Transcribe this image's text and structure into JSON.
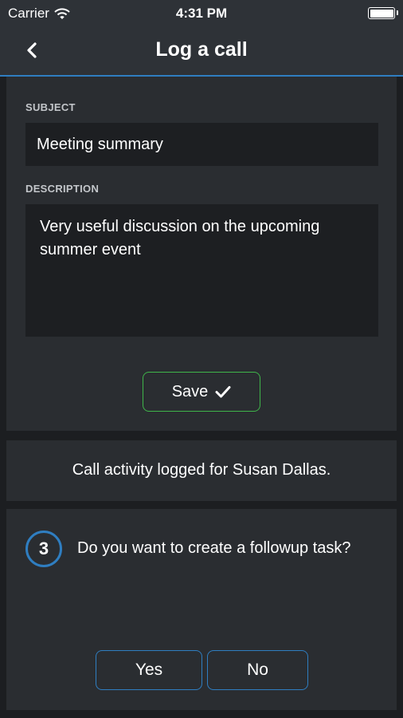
{
  "status_bar": {
    "carrier": "Carrier",
    "time": "4:31 PM",
    "wifi_icon": "wifi-icon",
    "battery_icon": "battery-icon"
  },
  "nav": {
    "title": "Log a call",
    "back_icon": "chevron-left-icon"
  },
  "form": {
    "subject_label": "SUBJECT",
    "subject_value": "Meeting summary",
    "description_label": "DESCRIPTION",
    "description_value": "Very useful discussion on the upcoming summer event",
    "save_label": "Save",
    "save_icon": "checkmark-icon"
  },
  "log_message": "Call activity logged for Susan Dallas.",
  "followup": {
    "step_number": "3",
    "question": "Do you want to create a followup task?",
    "yes_label": "Yes",
    "no_label": "No"
  },
  "colors": {
    "background": "#1c1e21",
    "card": "#2a2d31",
    "header": "#2e3237",
    "accent_blue": "#2f7ec1",
    "save_green": "#3fb54a"
  }
}
